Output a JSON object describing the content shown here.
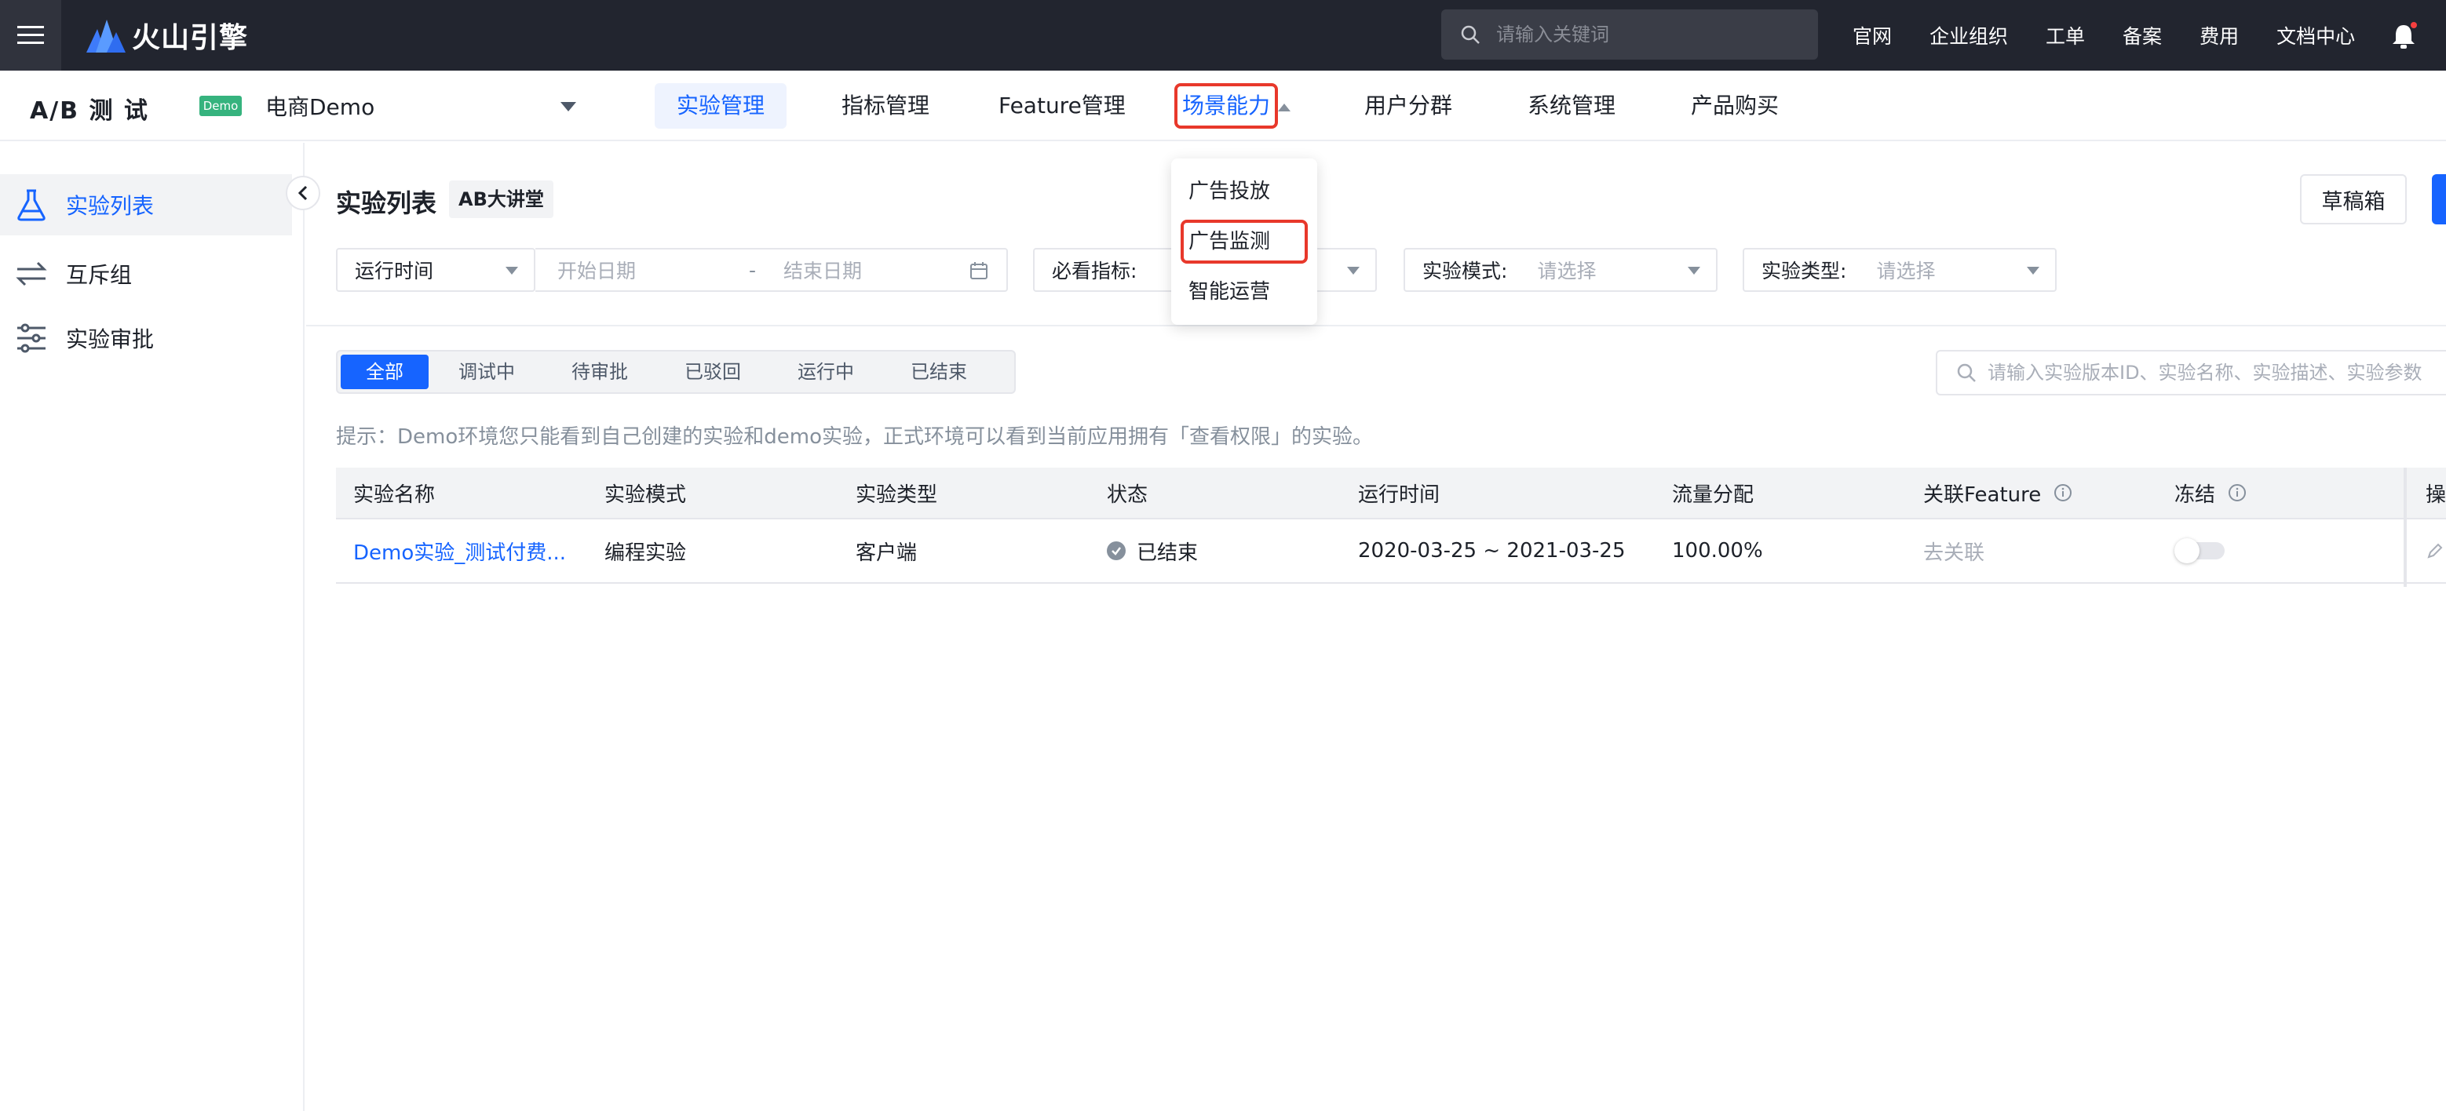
{
  "brand": {
    "logo_text": "火山引擎"
  },
  "top_search": {
    "placeholder": "请输入关键词"
  },
  "top_links": [
    "官网",
    "企业组织",
    "工单",
    "备案",
    "费用",
    "文档中心"
  ],
  "app": {
    "name": "A/B 测 试",
    "badge": "Demo",
    "project": "电商Demo"
  },
  "main_nav": {
    "experiment_mgmt": "实验管理",
    "metric_mgmt": "指标管理",
    "feature_mgmt": "Feature管理",
    "scene": "场景能力",
    "user_segment": "用户分群",
    "system_mgmt": "系统管理",
    "product_buy": "产品购买"
  },
  "scene_dropdown": [
    "广告投放",
    "广告监测",
    "智能运营"
  ],
  "sidebar": {
    "items": [
      {
        "label": "实验列表",
        "icon": "flask-icon",
        "active": true
      },
      {
        "label": "互斥组",
        "icon": "swap-arrows-icon",
        "active": false
      },
      {
        "label": "实验审批",
        "icon": "sliders-icon",
        "active": false
      }
    ]
  },
  "page": {
    "title": "实验列表",
    "tag": "AB大讲堂",
    "draft_button": "草稿箱"
  },
  "filters": {
    "runtime": "运行时间",
    "start_placeholder": "开始日期",
    "separator": "-",
    "end_placeholder": "结束日期",
    "metric_label": "必看指标:",
    "mode_label": "实验模式:",
    "mode_placeholder": "请选择",
    "type_label": "实验类型:",
    "type_placeholder": "请选择"
  },
  "status_tabs": [
    "全部",
    "调试中",
    "待审批",
    "已驳回",
    "运行中",
    "已结束"
  ],
  "list_search": {
    "placeholder": "请输入实验版本ID、实验名称、实验描述、实验参数"
  },
  "tip": "提示：Demo环境您只能看到自己创建的实验和demo实验，正式环境可以看到当前应用拥有「查看权限」的实验。",
  "table": {
    "columns": [
      "实验名称",
      "实验模式",
      "实验类型",
      "状态",
      "运行时间",
      "流量分配",
      "关联Feature",
      "冻结",
      "操作"
    ],
    "rows": [
      {
        "name": "Demo实验_测试付费...",
        "mode": "编程实验",
        "type": "客户端",
        "status": "已结束",
        "runtime": "2020-03-25 ~ 2021-03-25",
        "traffic": "100.00%",
        "feature": "去关联",
        "frozen": false
      }
    ]
  },
  "colors": {
    "accent": "#1664ff",
    "highlight_box": "#e8382b",
    "topbar": "#22252f",
    "demo_badge": "#36b37e"
  }
}
